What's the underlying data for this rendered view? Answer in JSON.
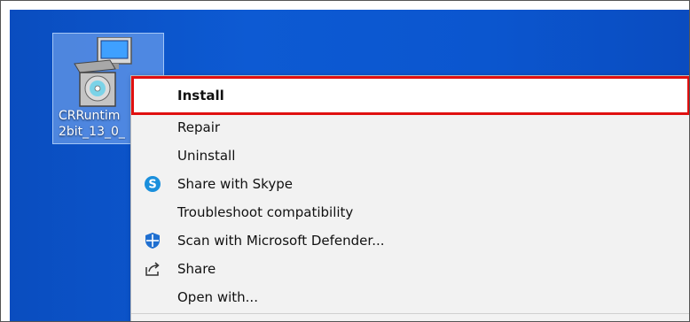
{
  "desktop": {
    "icon": {
      "name": "installer-icon",
      "label_line1": "CRRuntim",
      "label_line2": "2bit_13_0_"
    }
  },
  "context_menu": {
    "items": [
      {
        "label": "Install",
        "icon": "",
        "highlighted": true
      },
      {
        "label": "Repair",
        "icon": ""
      },
      {
        "label": "Uninstall",
        "icon": ""
      },
      {
        "label": "Share with Skype",
        "icon": "skype-icon"
      },
      {
        "label": "Troubleshoot compatibility",
        "icon": ""
      },
      {
        "label": "Scan with Microsoft Defender...",
        "icon": "defender-shield-icon"
      },
      {
        "label": "Share",
        "icon": "share-icon"
      },
      {
        "label": "Open with...",
        "icon": ""
      }
    ]
  },
  "colors": {
    "desktop_blue": "#0b56cf",
    "highlight_border": "#e01010",
    "skype_blue": "#1a8fdc",
    "defender_blue": "#1f6fd0"
  }
}
